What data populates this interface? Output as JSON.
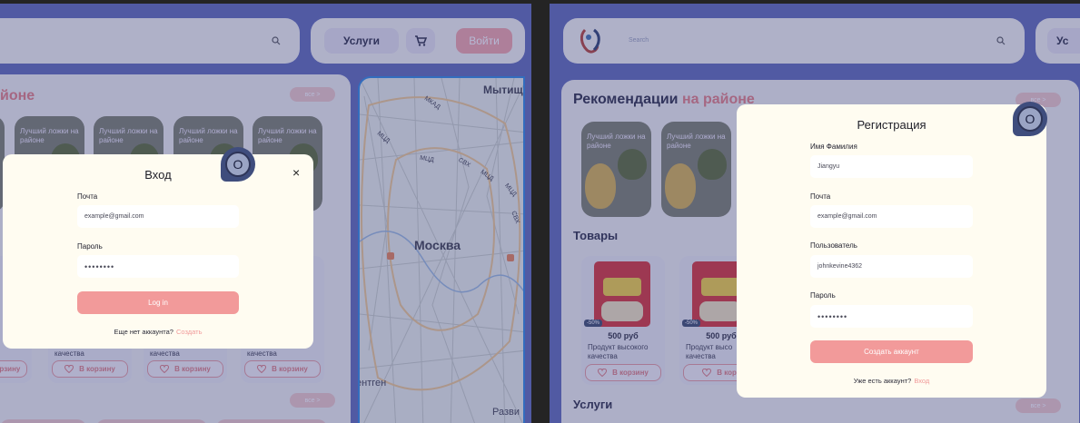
{
  "left": {
    "search_icon": "search-icon",
    "services_button": "Услуги",
    "cart_icon": "cart-icon",
    "login_button": "Войти",
    "section_title_accent": "йоне",
    "more_label": "все >",
    "rec_label": "Лучший ложки на районе",
    "products": [
      {
        "caption": "качества",
        "cart": "В корзину"
      },
      {
        "caption": "качества",
        "cart": "В корзину"
      },
      {
        "caption": "качества",
        "cart": "В корзину"
      }
    ],
    "more_label_2": "все >",
    "map": {
      "city": "Москва",
      "labels": [
        "Мытищ",
        "МКАД",
        "МЦД",
        "МЦД",
        "СВХ",
        "МЦД",
        "МЦД",
        "СВХ",
        "ентген",
        "Разви"
      ]
    },
    "login_modal": {
      "title": "Вход",
      "email_label": "Почта",
      "email_placeholder": "example@gmail.com",
      "password_label": "Пароль",
      "password_value": "••••••••",
      "submit": "Log in",
      "no_account": "Еще нет аккаунта?",
      "create_link": "Создать",
      "close": "×"
    },
    "avatar_letter": "O"
  },
  "right": {
    "search_placeholder": "Search",
    "services_button_partial": "Ус",
    "rec_title": "Рекомендации",
    "rec_title_accent": "на районе",
    "more_label": "все >",
    "rec_label": "Лучший ложки на районе",
    "goods_title": "Товары",
    "products": [
      {
        "badge": "-50%",
        "price": "500 руб",
        "caption": "Продукт высокого качества",
        "cart": "В корзину"
      },
      {
        "badge": "-50%",
        "price": "500 руб",
        "caption": "Продукт высо качества",
        "cart": "В корз"
      }
    ],
    "services_title": "Услуги",
    "more_label_2": "все >",
    "register_modal": {
      "title": "Регистрация",
      "name_label": "Имя Фамилия",
      "name_value": "Jiangyu",
      "email_label": "Почта",
      "email_placeholder": "example@gmail.com",
      "username_label": "Пользователь",
      "username_value": "johnkevine4362",
      "password_label": "Пароль",
      "password_value": "••••••••",
      "submit": "Создать аккаунт",
      "have_account": "Уже есть аккаунт?",
      "login_link": "Вход"
    },
    "avatar_letter": "O"
  }
}
